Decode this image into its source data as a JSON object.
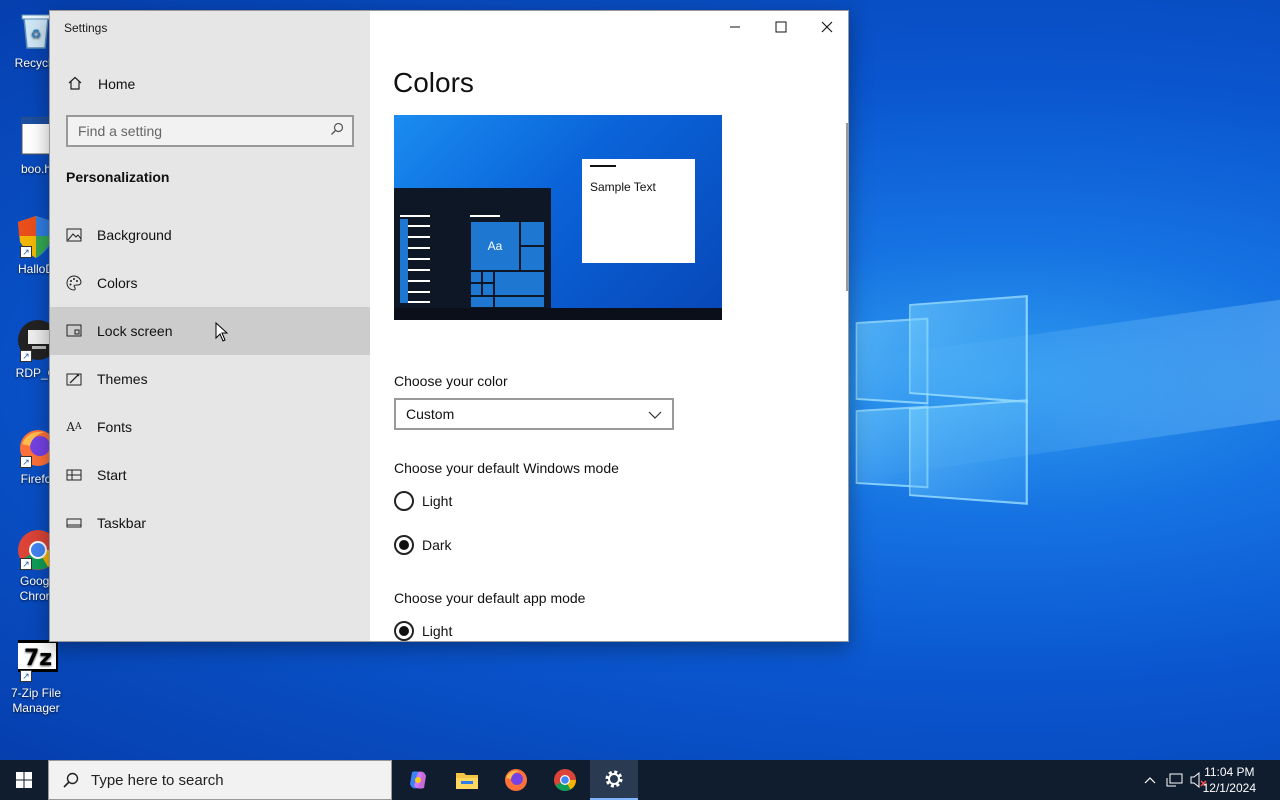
{
  "desktop": {
    "icons": [
      {
        "label": "Recycle"
      },
      {
        "label": "boo.h"
      },
      {
        "label": "HalloD"
      },
      {
        "label": "RDP_C"
      },
      {
        "label": "Firefo"
      },
      {
        "label": "Googl Chron"
      },
      {
        "label": "7-Zip File Manager"
      }
    ]
  },
  "window": {
    "title": "Settings",
    "controls": {
      "minimize": "–",
      "maximize": "☐",
      "close": "✕"
    }
  },
  "sidebar": {
    "home_label": "Home",
    "search_placeholder": "Find a setting",
    "section_title": "Personalization",
    "items": [
      {
        "label": "Background"
      },
      {
        "label": "Colors"
      },
      {
        "label": "Lock screen"
      },
      {
        "label": "Themes"
      },
      {
        "label": "Fonts"
      },
      {
        "label": "Start"
      },
      {
        "label": "Taskbar"
      }
    ]
  },
  "content": {
    "title": "Colors",
    "preview_sample_text": "Sample Text",
    "preview_tile_text": "Aa",
    "choose_color_label": "Choose your color",
    "choose_color_value": "Custom",
    "windows_mode_label": "Choose your default Windows mode",
    "windows_mode_options": [
      {
        "label": "Light",
        "selected": false
      },
      {
        "label": "Dark",
        "selected": true
      }
    ],
    "app_mode_label": "Choose your default app mode",
    "app_mode_options": [
      {
        "label": "Light",
        "selected": true
      }
    ]
  },
  "taskbar": {
    "search_placeholder": "Type here to search",
    "time": "11:04 PM",
    "date": "12/1/2024"
  }
}
